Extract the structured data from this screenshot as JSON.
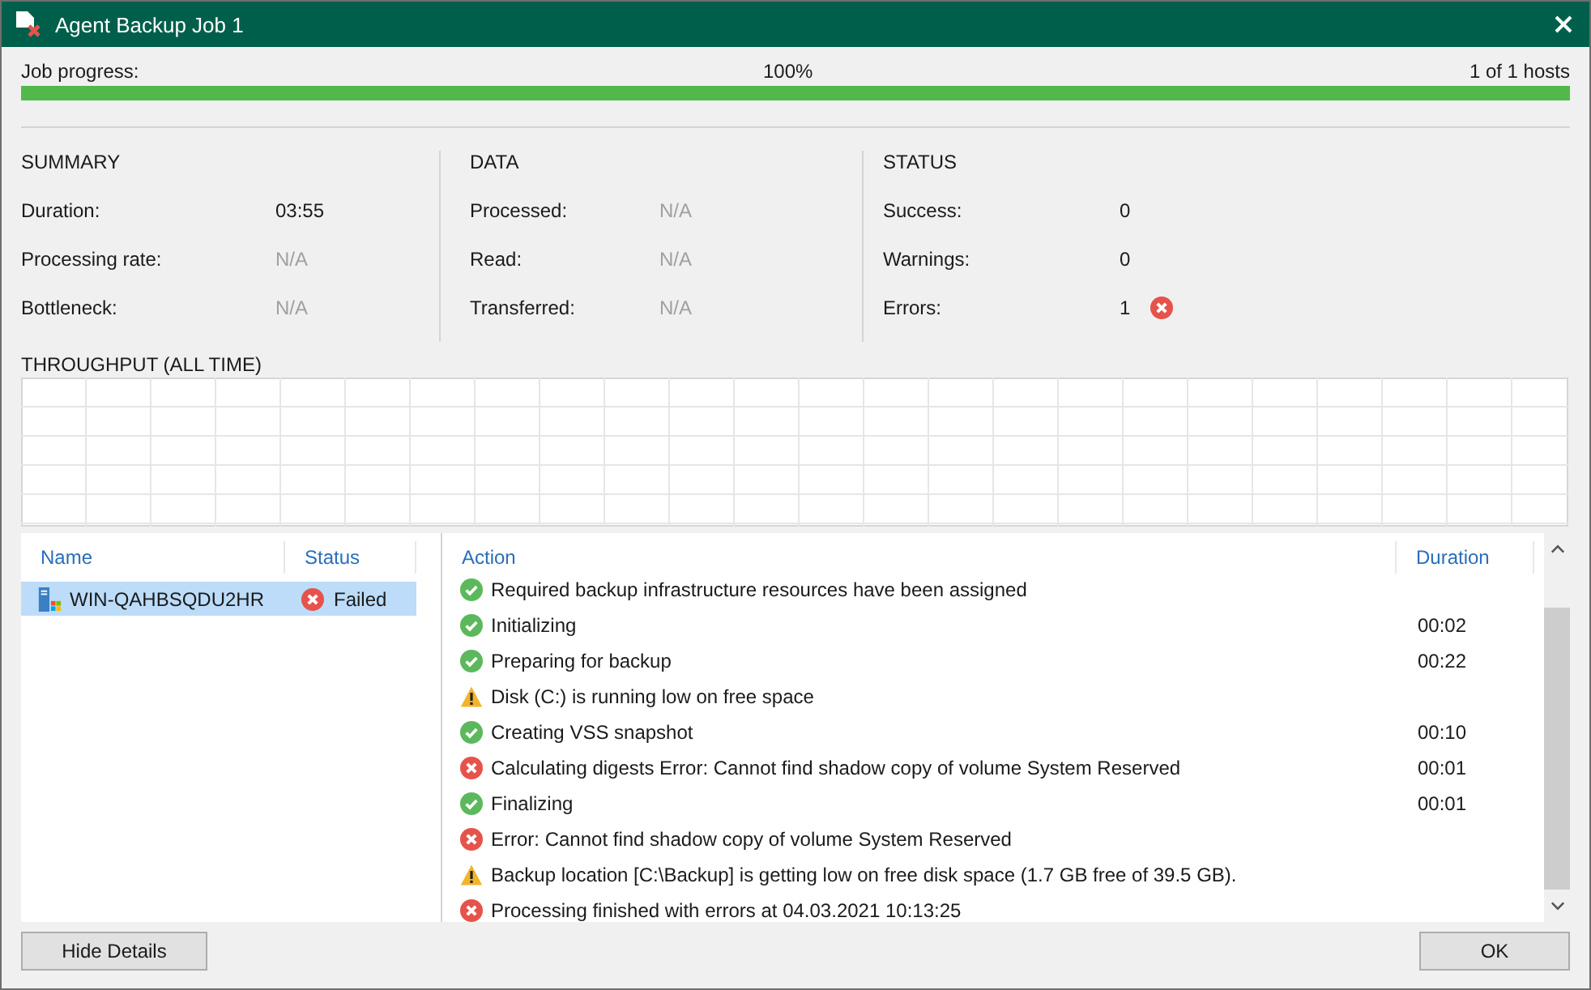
{
  "window": {
    "title": "Agent Backup Job 1"
  },
  "progress": {
    "label": "Job progress:",
    "percent": "100%",
    "hosts": "1 of 1 hosts",
    "level": 1
  },
  "sections": [
    {
      "title": "SUMMARY",
      "rows": [
        {
          "label": "Duration:",
          "value": "03:55",
          "muted": false
        },
        {
          "label": "Processing rate:",
          "value": "N/A",
          "muted": true
        },
        {
          "label": "Bottleneck:",
          "value": "N/A",
          "muted": true
        }
      ]
    },
    {
      "title": "DATA",
      "rows": [
        {
          "label": "Processed:",
          "value": "N/A",
          "muted": true
        },
        {
          "label": "Read:",
          "value": "N/A",
          "muted": true
        },
        {
          "label": "Transferred:",
          "value": "N/A",
          "muted": true
        }
      ]
    },
    {
      "title": "STATUS",
      "rows": [
        {
          "label": "Success:",
          "value": "0",
          "muted": false
        },
        {
          "label": "Warnings:",
          "value": "0",
          "muted": false
        },
        {
          "label": "Errors:",
          "value": "1",
          "muted": false,
          "kind": "error"
        }
      ]
    }
  ],
  "throughput": {
    "title": "THROUGHPUT (ALL TIME)"
  },
  "hosts": {
    "columns": [
      "Name",
      "Status"
    ],
    "rows": [
      {
        "name": "WIN-QAHBSQDU2HR",
        "status": "Failed",
        "kind": "error",
        "selected": true
      }
    ]
  },
  "log": {
    "columns": [
      "Action",
      "Duration"
    ],
    "rows": [
      {
        "kind": "success",
        "action": "Required backup infrastructure resources have been assigned"
      },
      {
        "kind": "success",
        "action": "Initializing",
        "duration": "00:02"
      },
      {
        "kind": "success",
        "action": "Preparing for backup",
        "duration": "00:22"
      },
      {
        "kind": "warning",
        "action": "Disk (C:) is running low on free space"
      },
      {
        "kind": "success",
        "action": "Creating VSS snapshot",
        "duration": "00:10"
      },
      {
        "kind": "error",
        "action": "Calculating digests Error: Cannot find shadow copy of volume System Reserved",
        "duration": "00:01"
      },
      {
        "kind": "success",
        "action": "Finalizing",
        "duration": "00:01"
      },
      {
        "kind": "error",
        "action": "Error: Cannot find shadow copy of volume System Reserved"
      },
      {
        "kind": "warning",
        "action": "Backup location [C:\\Backup] is getting low on free disk space (1.7 GB free of 39.5 GB)."
      },
      {
        "kind": "error",
        "action": "Processing finished with errors at 04.03.2021 10:13:25"
      }
    ]
  },
  "buttons": [
    {
      "label": "Hide Details"
    },
    {
      "label": "OK"
    }
  ]
}
